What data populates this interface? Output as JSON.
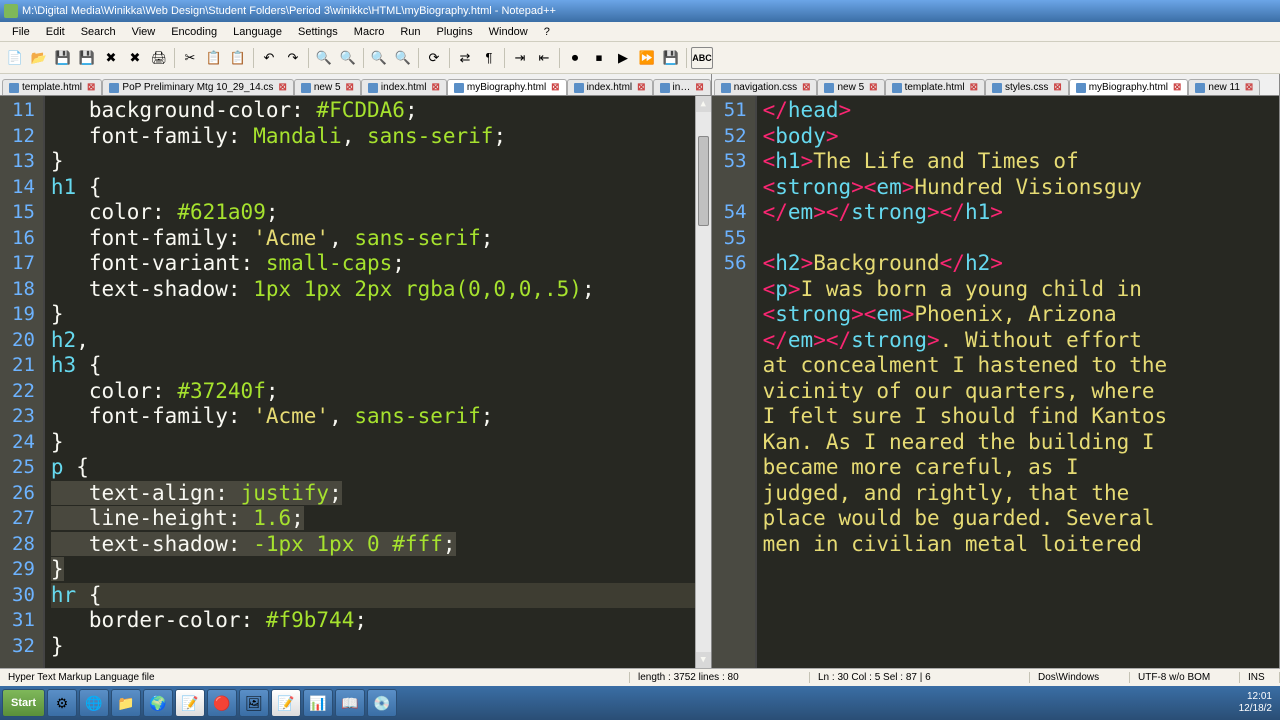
{
  "titlebar": "M:\\Digital Media\\Winikka\\Web Design\\Student Folders\\Period 3\\winikkc\\HTML\\myBiography.html - Notepad++",
  "menu": [
    "File",
    "Edit",
    "Search",
    "View",
    "Encoding",
    "Language",
    "Settings",
    "Macro",
    "Run",
    "Plugins",
    "Window",
    "?"
  ],
  "left_tabs": [
    {
      "label": "template.html",
      "active": false
    },
    {
      "label": "PoP Preliminary Mtg 10_29_14.cs",
      "active": false
    },
    {
      "label": "new  5",
      "active": false
    },
    {
      "label": "index.html",
      "active": false
    },
    {
      "label": "myBiography.html",
      "active": true
    },
    {
      "label": "index.html",
      "active": false
    },
    {
      "label": "in…",
      "active": false
    }
  ],
  "right_tabs": [
    {
      "label": "navigation.css",
      "active": false
    },
    {
      "label": "new  5",
      "active": false
    },
    {
      "label": "template.html",
      "active": false
    },
    {
      "label": "styles.css",
      "active": false
    },
    {
      "label": "myBiography.html",
      "active": true
    },
    {
      "label": "new  11",
      "active": false
    }
  ],
  "left_gutter": [
    11,
    12,
    13,
    14,
    15,
    16,
    17,
    18,
    19,
    20,
    21,
    22,
    23,
    24,
    25,
    26,
    27,
    28,
    29,
    30,
    31,
    32
  ],
  "right_gutter": [
    51,
    52,
    53,
    "",
    54,
    55,
    56,
    "",
    "",
    "",
    "",
    "",
    "",
    "",
    "",
    "",
    "",
    "",
    "",
    "",
    "",
    ""
  ],
  "left_code": [
    [
      [
        "p",
        "   "
      ],
      [
        "pr",
        "background-color"
      ],
      [
        "p",
        ": "
      ],
      [
        "v",
        "#FCDDA6"
      ],
      [
        "p",
        ";"
      ]
    ],
    [
      [
        "p",
        "   "
      ],
      [
        "pr",
        "font-family"
      ],
      [
        "p",
        ": "
      ],
      [
        "v",
        "Mandali"
      ],
      [
        "p",
        ", "
      ],
      [
        "v",
        "sans-serif"
      ],
      [
        "p",
        ";"
      ]
    ],
    [
      [
        "p",
        "}"
      ]
    ],
    [
      [
        "s",
        "h1"
      ],
      [
        "p",
        " {"
      ]
    ],
    [
      [
        "p",
        "   "
      ],
      [
        "pr",
        "color"
      ],
      [
        "p",
        ": "
      ],
      [
        "v",
        "#621a09"
      ],
      [
        "p",
        ";"
      ]
    ],
    [
      [
        "p",
        "   "
      ],
      [
        "pr",
        "font-family"
      ],
      [
        "p",
        ": "
      ],
      [
        "st",
        "'Acme'"
      ],
      [
        "p",
        ", "
      ],
      [
        "v",
        "sans-serif"
      ],
      [
        "p",
        ";"
      ]
    ],
    [
      [
        "p",
        "   "
      ],
      [
        "pr",
        "font-variant"
      ],
      [
        "p",
        ": "
      ],
      [
        "v",
        "small-caps"
      ],
      [
        "p",
        ";"
      ]
    ],
    [
      [
        "p",
        "   "
      ],
      [
        "pr",
        "text-shadow"
      ],
      [
        "p",
        ": "
      ],
      [
        "v",
        "1px 1px 2px rgba(0,0,0,.5)"
      ],
      [
        "p",
        ";"
      ]
    ],
    [
      [
        "p",
        "}"
      ]
    ],
    [
      [
        "s",
        "h2"
      ],
      [
        "p",
        ","
      ]
    ],
    [
      [
        "s",
        "h3"
      ],
      [
        "p",
        " {"
      ]
    ],
    [
      [
        "p",
        "   "
      ],
      [
        "pr",
        "color"
      ],
      [
        "p",
        ": "
      ],
      [
        "v",
        "#37240f"
      ],
      [
        "p",
        ";"
      ]
    ],
    [
      [
        "p",
        "   "
      ],
      [
        "pr",
        "font-family"
      ],
      [
        "p",
        ": "
      ],
      [
        "st",
        "'Acme'"
      ],
      [
        "p",
        ", "
      ],
      [
        "v",
        "sans-serif"
      ],
      [
        "p",
        ";"
      ]
    ],
    [
      [
        "p",
        "}"
      ]
    ],
    [
      [
        "s",
        "p"
      ],
      [
        "p",
        " {"
      ]
    ],
    [
      [
        "sel",
        "   "
      ],
      [
        "sel-pr",
        "text-align"
      ],
      [
        "sel",
        ": "
      ],
      [
        "sel-v",
        "justify"
      ],
      [
        "sel",
        ";"
      ]
    ],
    [
      [
        "sel",
        "   "
      ],
      [
        "sel-pr",
        "line-height"
      ],
      [
        "sel",
        ": "
      ],
      [
        "sel-v",
        "1.6"
      ],
      [
        "sel",
        ";"
      ]
    ],
    [
      [
        "sel",
        "   "
      ],
      [
        "sel-pr",
        "text-shadow"
      ],
      [
        "sel",
        ": "
      ],
      [
        "sel-v",
        "-1px 1px 0 #fff"
      ],
      [
        "sel",
        ";"
      ]
    ],
    [
      [
        "sel",
        "}"
      ]
    ],
    [
      [
        "hl",
        ""
      ],
      [
        "s",
        "hr"
      ],
      [
        "p",
        " {"
      ]
    ],
    [
      [
        "p",
        "   "
      ],
      [
        "pr",
        "border-color"
      ],
      [
        "p",
        ": "
      ],
      [
        "v",
        "#f9b744"
      ],
      [
        "p",
        ";"
      ]
    ],
    [
      [
        "p",
        "}"
      ]
    ]
  ],
  "right_code": [
    [
      [
        "t",
        "</"
      ],
      [
        "tn",
        "head"
      ],
      [
        "t",
        ">"
      ]
    ],
    [
      [
        "t",
        "<"
      ],
      [
        "tn",
        "body"
      ],
      [
        "t",
        ">"
      ]
    ],
    [
      [
        "t",
        "<"
      ],
      [
        "tn",
        "h1"
      ],
      [
        "t",
        ">"
      ],
      [
        "tx",
        "The Life and Times of "
      ]
    ],
    [
      [
        "t",
        "<"
      ],
      [
        "tn",
        "strong"
      ],
      [
        "t",
        "><"
      ],
      [
        "tn",
        "em"
      ],
      [
        "t",
        ">"
      ],
      [
        "tx",
        "Hundred Visionsguy"
      ]
    ],
    [
      [
        "t",
        "</"
      ],
      [
        "tn",
        "em"
      ],
      [
        "t",
        "></"
      ],
      [
        "tn",
        "strong"
      ],
      [
        "t",
        "></"
      ],
      [
        "tn",
        "h1"
      ],
      [
        "t",
        ">"
      ]
    ],
    [
      [
        "tx",
        ""
      ]
    ],
    [
      [
        "t",
        "<"
      ],
      [
        "tn",
        "h2"
      ],
      [
        "t",
        ">"
      ],
      [
        "tx",
        "Background"
      ],
      [
        "t",
        "</"
      ],
      [
        "tn",
        "h2"
      ],
      [
        "t",
        ">"
      ]
    ],
    [
      [
        "t",
        "<"
      ],
      [
        "tn",
        "p"
      ],
      [
        "t",
        ">"
      ],
      [
        "tx",
        "I was born a young child in "
      ]
    ],
    [
      [
        "t",
        "<"
      ],
      [
        "tn",
        "strong"
      ],
      [
        "t",
        "><"
      ],
      [
        "tn",
        "em"
      ],
      [
        "t",
        ">"
      ],
      [
        "tx",
        "Phoenix, Arizona"
      ]
    ],
    [
      [
        "t",
        "</"
      ],
      [
        "tn",
        "em"
      ],
      [
        "t",
        "></"
      ],
      [
        "tn",
        "strong"
      ],
      [
        "t",
        ">"
      ],
      [
        "tx",
        ". Without effort "
      ]
    ],
    [
      [
        "tx",
        "at concealment I hastened to the "
      ]
    ],
    [
      [
        "tx",
        "vicinity of our quarters, where "
      ]
    ],
    [
      [
        "tx",
        "I felt sure I should find Kantos "
      ]
    ],
    [
      [
        "tx",
        "Kan. As I neared the building I "
      ]
    ],
    [
      [
        "tx",
        "became more careful, as I "
      ]
    ],
    [
      [
        "tx",
        "judged, and rightly, that the "
      ]
    ],
    [
      [
        "tx",
        "place would be guarded. Several "
      ]
    ],
    [
      [
        "tx",
        "men in civilian metal loitered "
      ]
    ]
  ],
  "status": {
    "filetype": "Hyper Text Markup Language file",
    "length": "length : 3752    lines : 80",
    "pos": "Ln : 30    Col : 5    Sel : 87 | 6",
    "eol": "Dos\\Windows",
    "enc": "UTF-8 w/o BOM",
    "ins": "INS"
  },
  "taskbar": {
    "start": "Start",
    "time": "12:01",
    "date": "12/18/2"
  }
}
